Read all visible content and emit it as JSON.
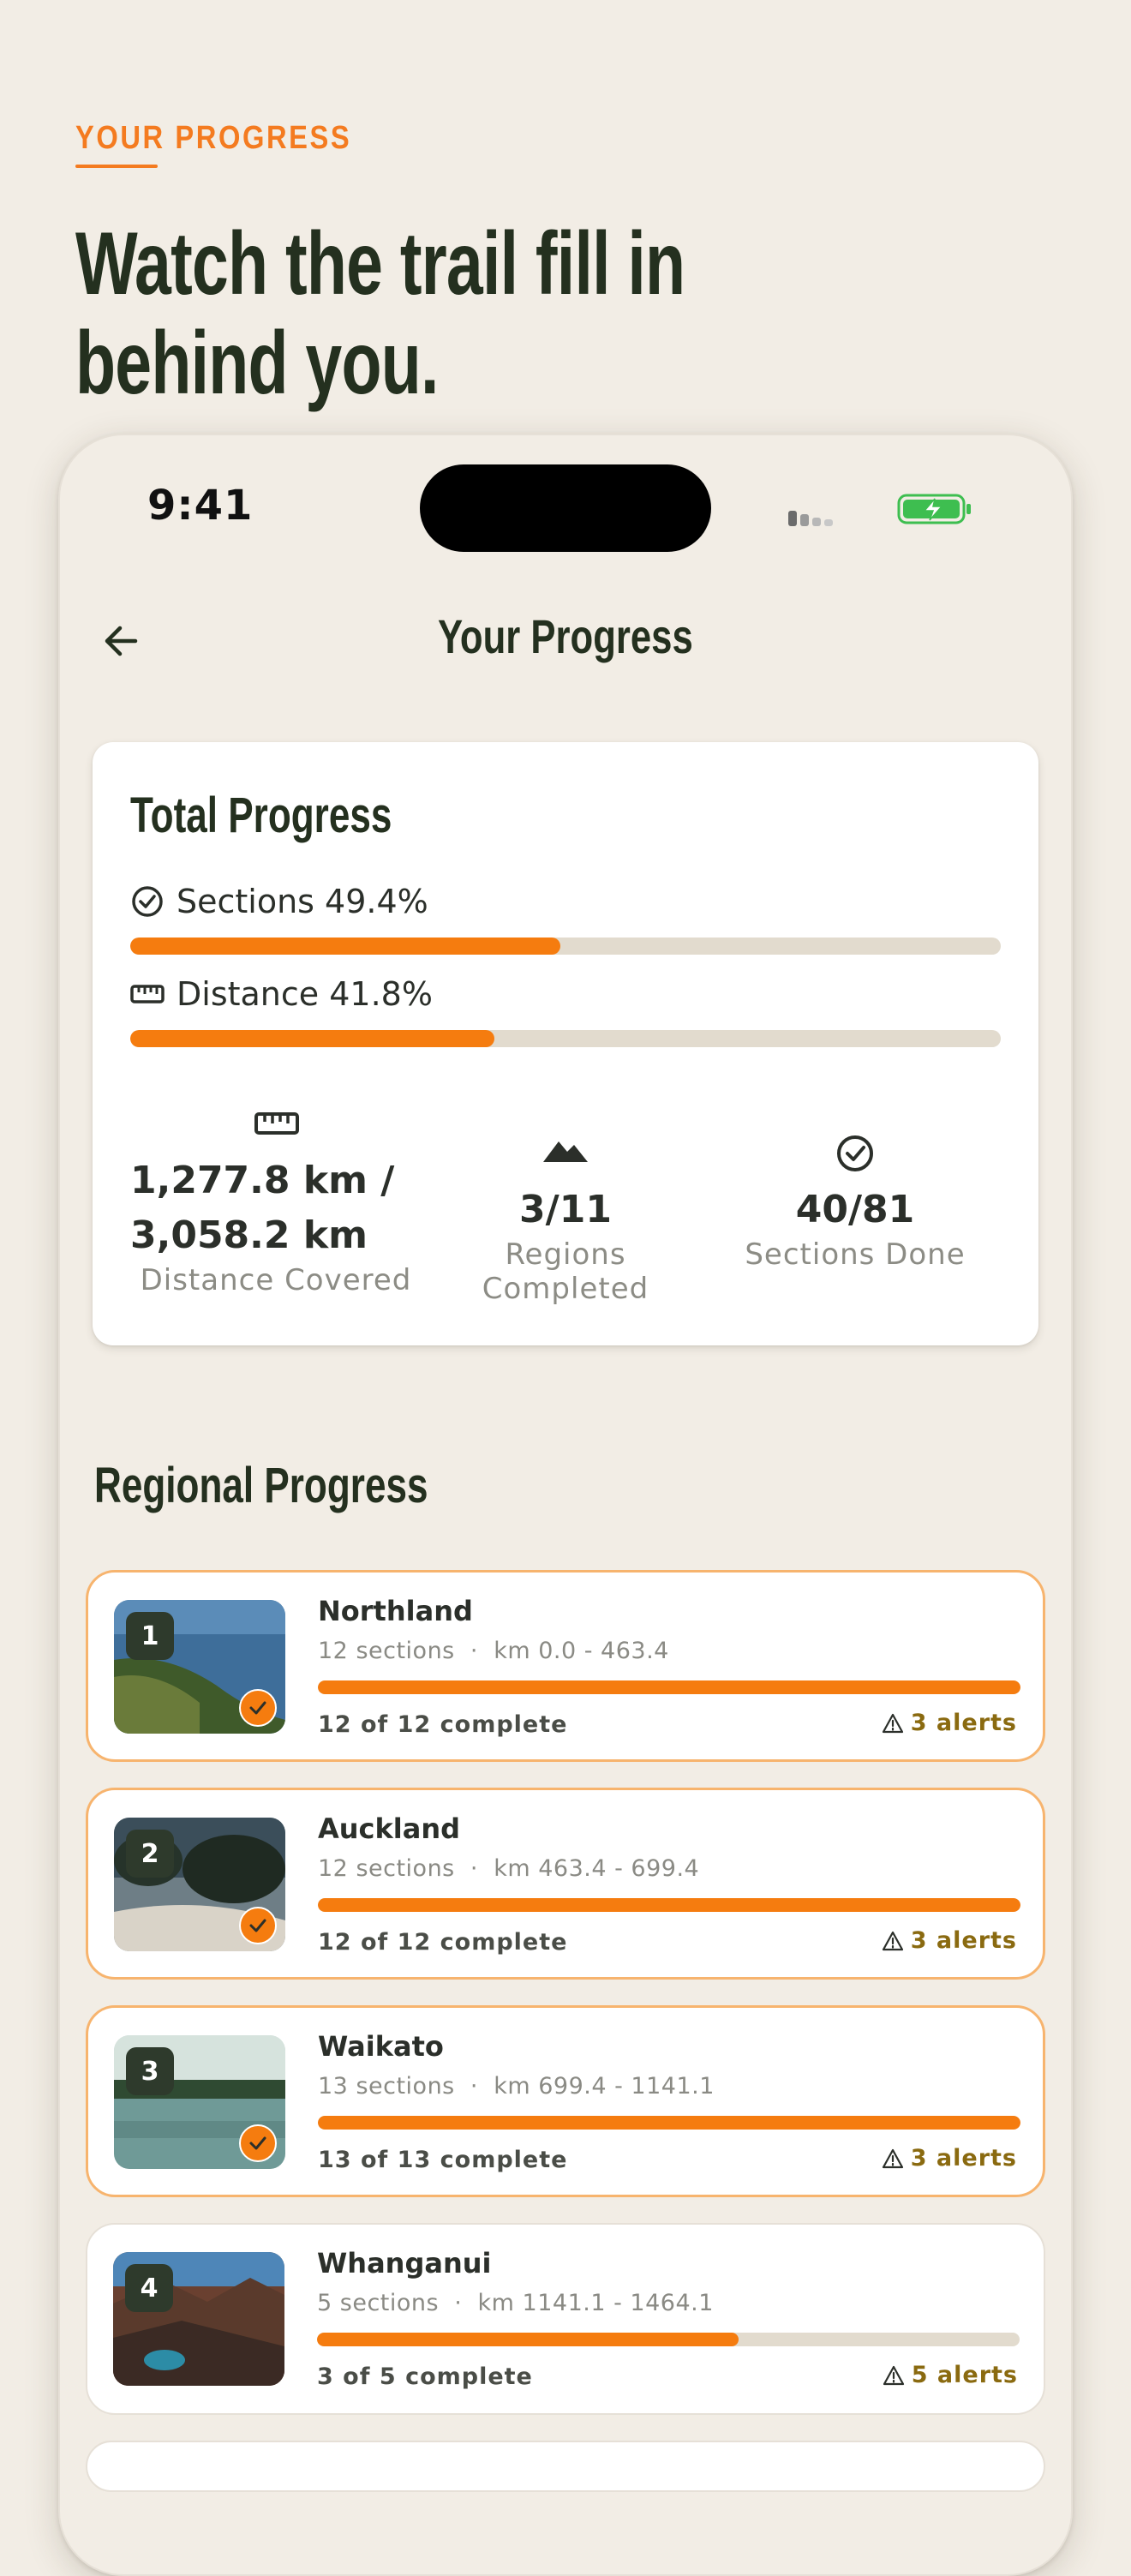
{
  "intro": {
    "eyebrow": "YOUR PROGRESS",
    "headline": "Watch the trail fill in behind you."
  },
  "status_bar": {
    "time": "9:41"
  },
  "header": {
    "title": "Your Progress",
    "back_icon": "arrow-left-icon"
  },
  "total_progress": {
    "title": "Total Progress",
    "sections_label": "Sections 49.4%",
    "sections_fraction": 0.494,
    "distance_label": "Distance 41.8%",
    "distance_fraction": 0.418,
    "stats": [
      {
        "icon": "ruler-icon",
        "value": "1,277.8 km /\n3,058.2 km",
        "label": "Distance Covered"
      },
      {
        "icon": "mountain-icon",
        "value": "3/11",
        "label": "Regions Completed"
      },
      {
        "icon": "check-circle-icon",
        "value": "40/81",
        "label": "Sections Done"
      }
    ]
  },
  "regional": {
    "title": "Regional Progress",
    "regions": [
      {
        "number": "1",
        "name": "Northland",
        "sections": "12 sections",
        "range": "km 0.0 - 463.4",
        "count": "12 of 12 complete",
        "alerts": "3 alerts",
        "fraction": 1.0,
        "complete": true
      },
      {
        "number": "2",
        "name": "Auckland",
        "sections": "12 sections",
        "range": "km 463.4 - 699.4",
        "count": "12 of 12 complete",
        "alerts": "3 alerts",
        "fraction": 1.0,
        "complete": true
      },
      {
        "number": "3",
        "name": "Waikato",
        "sections": "13 sections",
        "range": "km 699.4 - 1141.1",
        "count": "13 of 13 complete",
        "alerts": "3 alerts",
        "fraction": 1.0,
        "complete": true
      },
      {
        "number": "4",
        "name": "Whanganui",
        "sections": "5 sections",
        "range": "km 1141.1 - 1464.1",
        "count": "3 of 5 complete",
        "alerts": "5 alerts",
        "fraction": 0.6,
        "complete": false
      }
    ],
    "separator": "·"
  },
  "colors": {
    "accent": "#F57C0F",
    "ink": "#24301F",
    "background": "#F2EDE5",
    "track": "#E2DBCE",
    "alert": "#8A6A10"
  }
}
